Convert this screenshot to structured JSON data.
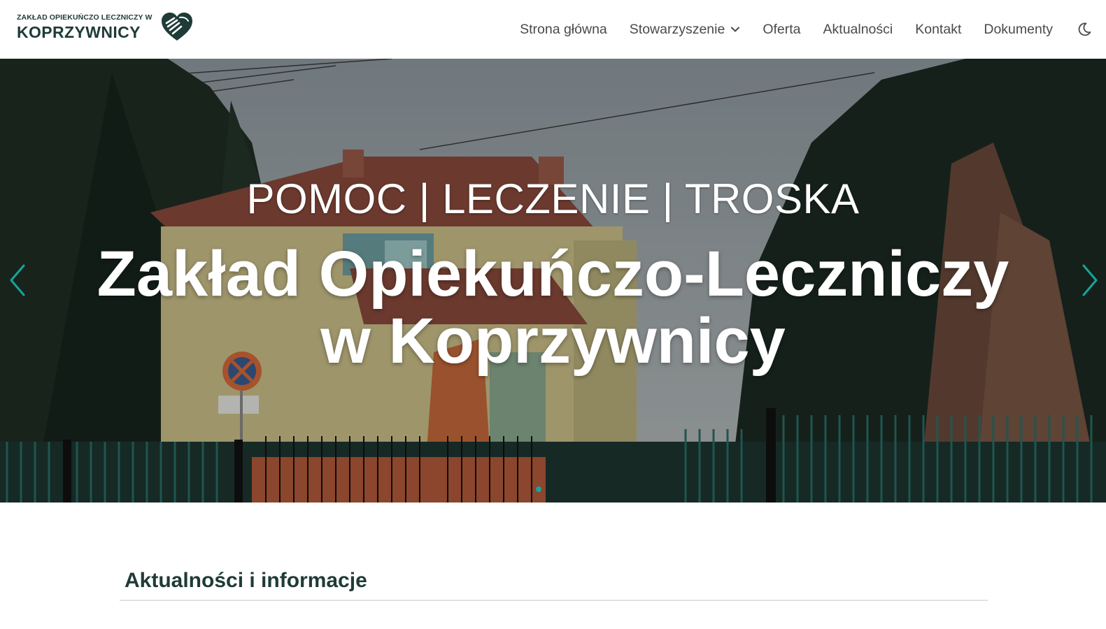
{
  "header": {
    "logo_small": "ZAKŁAD OPIEKUŃCZO LECZNICZY W",
    "logo_big": "KOPRZYWNICY",
    "brand_color": "#1f3b37",
    "icons": {
      "logo": "heart-hands-icon",
      "theme": "moon-icon",
      "dropdown": "chevron-down-icon"
    }
  },
  "nav": {
    "items": [
      {
        "label": "Strona główna"
      },
      {
        "label": "Stowarzyszenie",
        "dropdown": true
      },
      {
        "label": "Oferta"
      },
      {
        "label": "Aktualności"
      },
      {
        "label": "Kontakt"
      },
      {
        "label": "Dokumenty"
      }
    ]
  },
  "hero": {
    "tagline": "POMOC | LECZENIE | TROSKA",
    "title_line1": "Zakład Opiekuńczo-Leczniczy",
    "title_line2": "w Koprzywnicy",
    "accent_color": "#16a69a",
    "icons": {
      "prev": "chevron-left-icon",
      "next": "chevron-right-icon"
    }
  },
  "news": {
    "heading": "Aktualności i informacje"
  }
}
